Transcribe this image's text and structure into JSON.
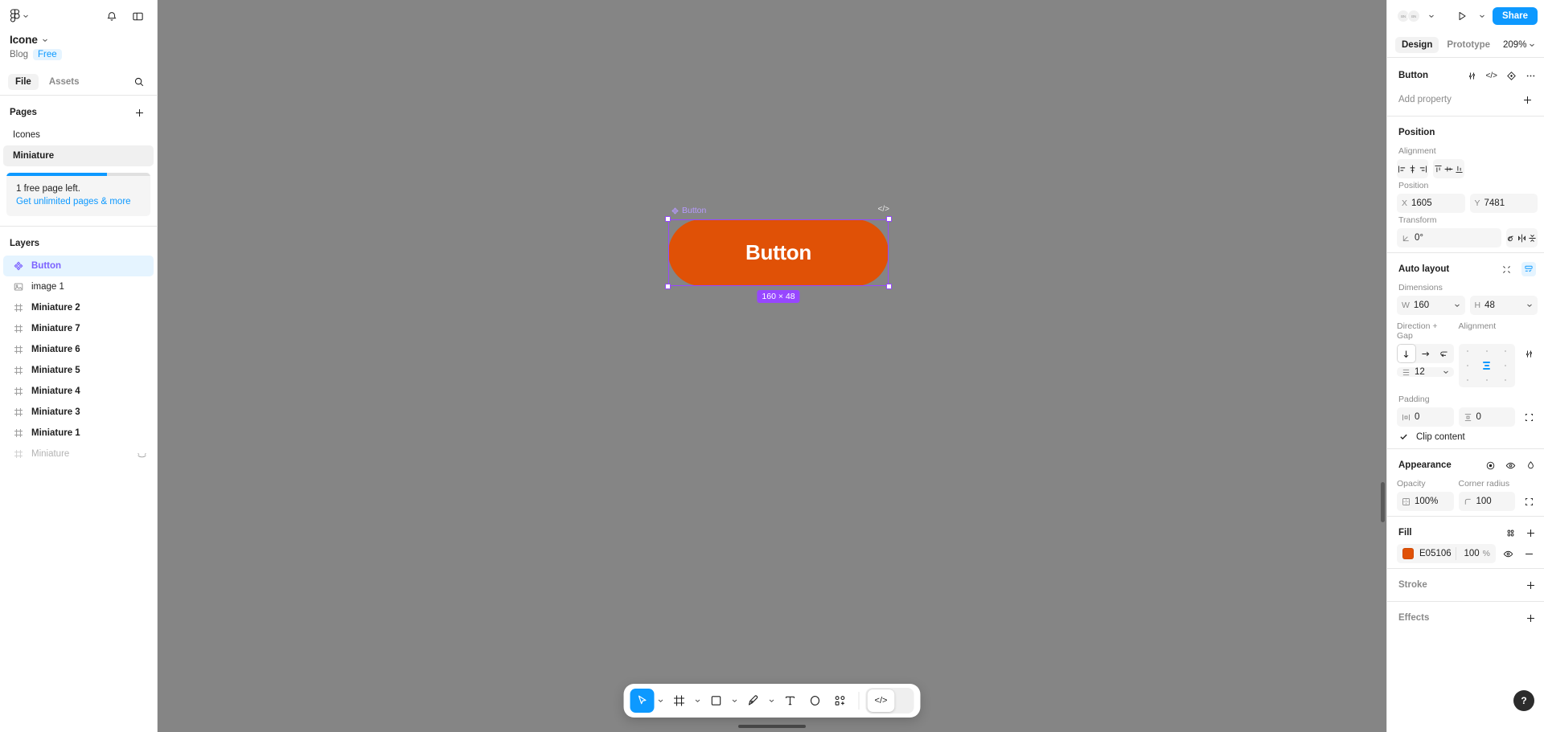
{
  "left_sidebar": {
    "logo_icon": "figma-logo-icon",
    "notifications_icon": "bell-icon",
    "panel_toggle_icon": "layout-panel-icon",
    "file_title": "Icone",
    "blog_label": "Blog",
    "plan_badge": "Free",
    "tabs": [
      {
        "label": "File",
        "active": true
      },
      {
        "label": "Assets",
        "active": false
      }
    ],
    "search_icon": "search-icon",
    "pages_section": {
      "title": "Pages",
      "add_icon": "plus-icon",
      "items": [
        {
          "label": "Icones",
          "active": false
        },
        {
          "label": "Miniature",
          "active": true
        }
      ]
    },
    "upsell": {
      "progress_percent": 70,
      "line1": "1 free page left.",
      "link": "Get unlimited pages & more"
    },
    "layers_section": {
      "title": "Layers",
      "items": [
        {
          "label": "Button",
          "icon": "component-icon",
          "state": "selected"
        },
        {
          "label": "image 1",
          "icon": "image-icon",
          "state": "plain"
        },
        {
          "label": "Miniature 2",
          "icon": "frame-icon",
          "state": "normal"
        },
        {
          "label": "Miniature 7",
          "icon": "frame-icon",
          "state": "normal"
        },
        {
          "label": "Miniature 6",
          "icon": "frame-icon",
          "state": "normal"
        },
        {
          "label": "Miniature 5",
          "icon": "frame-icon",
          "state": "normal"
        },
        {
          "label": "Miniature 4",
          "icon": "frame-icon",
          "state": "normal"
        },
        {
          "label": "Miniature 3",
          "icon": "frame-icon",
          "state": "normal"
        },
        {
          "label": "Miniature 1",
          "icon": "frame-icon",
          "state": "normal"
        },
        {
          "label": "Miniature",
          "icon": "frame-icon",
          "state": "dimmed",
          "trailing_icon": "hidden-eye-icon"
        }
      ]
    }
  },
  "canvas": {
    "background_color": "#858585",
    "selection": {
      "name": "Button",
      "name_icon": "component-icon",
      "code_icon": "code-icon",
      "size_badge": "160 × 48",
      "fill_color": "#E05106",
      "button_text": "Button",
      "selection_color": "#9747ff"
    }
  },
  "toolbar": {
    "tools": [
      {
        "name": "move-tool",
        "icon": "cursor-icon",
        "active": true,
        "has_caret": true
      },
      {
        "name": "frame-tool",
        "icon": "frame-icon",
        "active": false,
        "has_caret": true
      },
      {
        "name": "shape-tool",
        "icon": "square-icon",
        "active": false,
        "has_caret": true
      },
      {
        "name": "pen-tool",
        "icon": "pen-icon",
        "active": false,
        "has_caret": true
      },
      {
        "name": "text-tool",
        "icon": "text-icon",
        "active": false,
        "has_caret": false
      },
      {
        "name": "ellipse-tool",
        "icon": "ellipse-icon",
        "active": false,
        "has_caret": false
      },
      {
        "name": "component-tool",
        "icon": "components-icon",
        "active": false,
        "has_caret": false
      }
    ],
    "code_button_icon": "code-icon"
  },
  "right_panel": {
    "avatars": [
      {
        "initials": "BN"
      },
      {
        "initials": "BN"
      }
    ],
    "avatar_caret_icon": "chevron-down-icon",
    "present_icon": "play-icon",
    "present_caret_icon": "chevron-down-icon",
    "share_label": "Share",
    "tabs": [
      {
        "label": "Design",
        "active": true
      },
      {
        "label": "Prototype",
        "active": false
      }
    ],
    "zoom_level": "209%",
    "zoom_caret_icon": "chevron-down-icon",
    "selection_title": "Button",
    "header_icons": [
      {
        "name": "tune-icon"
      },
      {
        "name": "code-icon"
      },
      {
        "name": "component-target-icon"
      },
      {
        "name": "more-options-icon"
      }
    ],
    "add_property": {
      "label": "Add property",
      "icon": "plus-icon"
    },
    "position_section": {
      "title": "Position",
      "alignment_label": "Alignment",
      "align_buttons": [
        {
          "name": "align-left-icon"
        },
        {
          "name": "align-horizontal-center-icon"
        },
        {
          "name": "align-right-icon"
        },
        {
          "name": "align-top-icon"
        },
        {
          "name": "align-vertical-center-icon"
        },
        {
          "name": "align-bottom-icon"
        }
      ],
      "position_label": "Position",
      "x": {
        "prefix": "X",
        "value": "1605"
      },
      "y": {
        "prefix": "Y",
        "value": "7481"
      },
      "transform_label": "Transform",
      "rotation": {
        "prefix": "angle-icon",
        "value": "0°"
      },
      "transform_buttons": [
        {
          "name": "corner-radius-independent-icon"
        },
        {
          "name": "flip-horizontal-icon"
        },
        {
          "name": "flip-vertical-icon"
        }
      ]
    },
    "autolayout_section": {
      "title": "Auto layout",
      "collapse_icon": "collapse-icon",
      "settings_icon": "autolayout-settings-icon",
      "dimensions_label": "Dimensions",
      "width": {
        "prefix": "W",
        "value": "160"
      },
      "height": {
        "prefix": "H",
        "value": "48"
      },
      "direction_label": "Direction + Gap",
      "directions": [
        {
          "name": "direction-vertical-icon",
          "active": true
        },
        {
          "name": "direction-horizontal-icon",
          "active": false
        },
        {
          "name": "direction-wrap-icon",
          "active": false
        }
      ],
      "gap": {
        "prefix": "gap-icon",
        "value": "12"
      },
      "alignment_label": "Alignment",
      "align_advanced_icon": "tune-icon",
      "padding_label": "Padding",
      "padding_horizontal": {
        "prefix": "padding-horizontal-icon",
        "value": "0"
      },
      "padding_vertical": {
        "prefix": "padding-vertical-icon",
        "value": "0"
      },
      "padding_individual_icon": "padding-individual-icon",
      "clip_content": {
        "label": "Clip content",
        "checked": true
      }
    },
    "appearance_section": {
      "title": "Appearance",
      "icons": [
        {
          "name": "blend-mode-icon"
        },
        {
          "name": "visibility-eye-icon"
        },
        {
          "name": "color-drop-icon"
        }
      ],
      "opacity_label": "Opacity",
      "opacity": {
        "prefix": "opacity-icon",
        "value": "100%"
      },
      "corner_radius_label": "Corner radius",
      "corner_radius": {
        "prefix": "corner-radius-icon",
        "value": "100"
      },
      "individual_corners_icon": "individual-corners-icon"
    },
    "fill_section": {
      "title": "Fill",
      "styles_icon": "style-library-icon",
      "add_icon": "plus-icon",
      "fills": [
        {
          "hex": "E05106",
          "color": "#E05106",
          "opacity": "100",
          "opacity_unit": "%",
          "visibility_icon": "visibility-eye-icon",
          "remove_icon": "minus-icon"
        }
      ]
    },
    "stroke_section": {
      "title": "Stroke",
      "add_icon": "plus-icon"
    },
    "effects_section": {
      "title": "Effects",
      "add_icon": "plus-icon"
    },
    "help_button": "?"
  }
}
